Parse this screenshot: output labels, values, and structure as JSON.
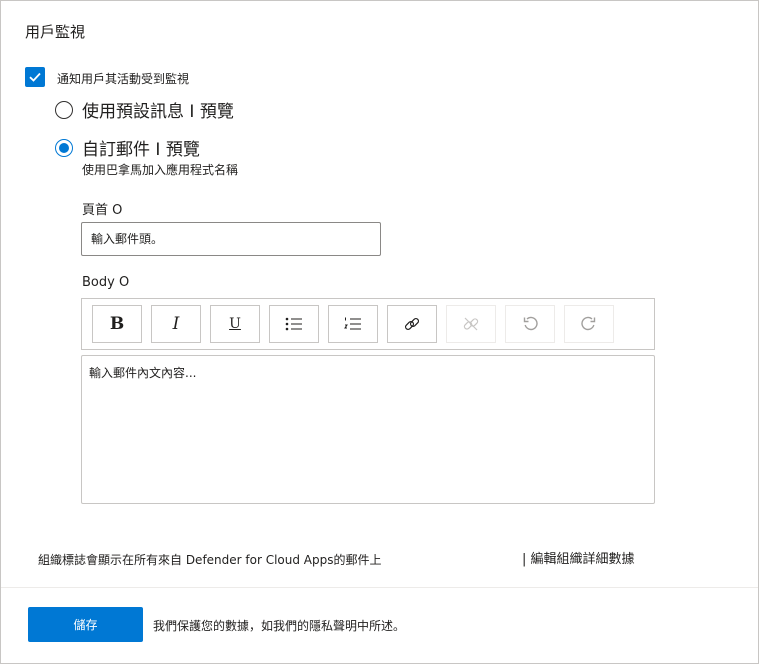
{
  "page": {
    "title": "用戶監視"
  },
  "notify": {
    "label": "通知用戶其活動受到監視",
    "checked": true
  },
  "options": {
    "default": {
      "label": "使用預設訊息 I 預覽",
      "checked": false
    },
    "custom": {
      "label": "自訂郵件 I 預覽",
      "checked": true,
      "hint": "使用巴拿馬加入應用程式名稱"
    }
  },
  "header_field": {
    "label": "頁首 O",
    "placeholder": "輸入郵件頭。"
  },
  "body_field": {
    "label": "Body O",
    "placeholder": "輸入郵件內文內容..."
  },
  "toolbar": {
    "bold": "B",
    "italic": "I",
    "underline": "U"
  },
  "org": {
    "notice": "組織標誌會顯示在所有來自 Defender for Cloud Apps的郵件上",
    "edit_link": "| 編輯組織詳細數據"
  },
  "footer": {
    "save_label": "儲存",
    "privacy_text": "我們保護您的數據，如我們的隱私聲明中所述。"
  },
  "colors": {
    "accent": "#0078d4",
    "border": "#c8c6c4",
    "text": "#201f1e"
  }
}
